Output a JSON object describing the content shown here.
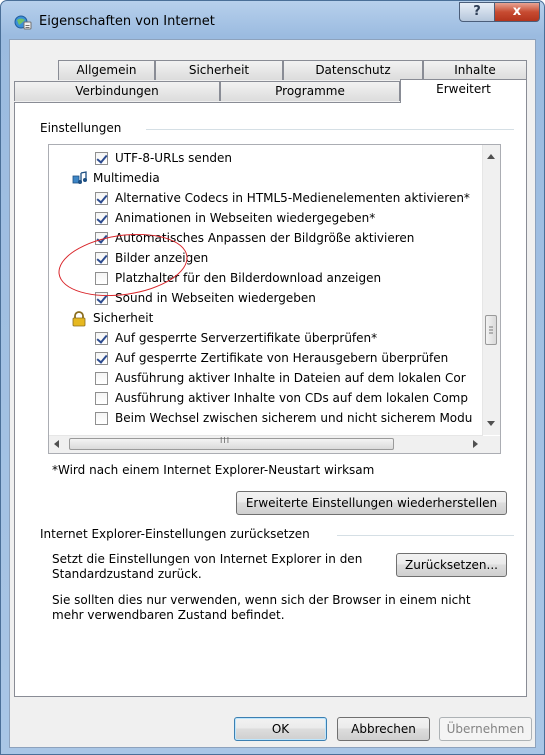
{
  "window": {
    "title": "Eigenschaften von Internet",
    "help_label": "?",
    "close_label": "x"
  },
  "tabs_row1": [
    {
      "label": "Allgemein"
    },
    {
      "label": "Sicherheit"
    },
    {
      "label": "Datenschutz"
    },
    {
      "label": "Inhalte"
    }
  ],
  "tabs_row2": [
    {
      "label": "Verbindungen"
    },
    {
      "label": "Programme"
    },
    {
      "label": "Erweitert",
      "selected": true
    }
  ],
  "settings": {
    "group_label": "Einstellungen",
    "items": [
      {
        "type": "checkbox",
        "label": "UTF-8-URLs senden",
        "checked": true
      },
      {
        "type": "category",
        "label": "Multimedia",
        "icon": "multimedia-icon"
      },
      {
        "type": "checkbox",
        "label": "Alternative Codecs in HTML5-Medienelementen aktivieren*",
        "checked": true
      },
      {
        "type": "checkbox",
        "label": "Animationen in Webseiten wiedergegeben*",
        "checked": true
      },
      {
        "type": "checkbox",
        "label": "Automatisches Anpassen der Bildgröße aktivieren",
        "checked": true
      },
      {
        "type": "checkbox",
        "label": "Bilder anzeigen",
        "checked": true
      },
      {
        "type": "checkbox",
        "label": "Platzhalter für den Bilderdownload anzeigen",
        "checked": false
      },
      {
        "type": "checkbox",
        "label": "Sound in Webseiten wiedergeben",
        "checked": true
      },
      {
        "type": "category",
        "label": "Sicherheit",
        "icon": "lock-icon"
      },
      {
        "type": "checkbox",
        "label": "Auf gesperrte Serverzertifikate überprüfen*",
        "checked": true
      },
      {
        "type": "checkbox",
        "label": "Auf gesperrte Zertifikate von Herausgebern überprüfen",
        "checked": true
      },
      {
        "type": "checkbox",
        "label": "Ausführung aktiver Inhalte in Dateien auf dem lokalen Cor",
        "checked": false
      },
      {
        "type": "checkbox",
        "label": "Ausführung aktiver Inhalte von CDs auf dem lokalen Comp",
        "checked": false
      },
      {
        "type": "checkbox",
        "label": "Beim Wechsel zwischen sicherem und nicht sicherem Modu",
        "checked": false
      }
    ],
    "hscroll_grip": "III",
    "restart_note": "*Wird nach einem Internet Explorer-Neustart wirksam",
    "restore_button": "Erweiterte Einstellungen wiederherstellen"
  },
  "reset": {
    "group_label": "Internet Explorer-Einstellungen zurücksetzen",
    "description_line1": "Setzt die Einstellungen von Internet Explorer in den",
    "description_line2": "Standardzustand zurück.",
    "button_label": "Zurücksetzen...",
    "warning_line1": "Sie sollten dies nur verwenden, wenn sich der Browser in einem nicht",
    "warning_line2": "mehr verwendbaren Zustand befindet."
  },
  "footer": {
    "ok_label": "OK",
    "cancel_label": "Abbrechen",
    "apply_label": "Übernehmen"
  },
  "colors": {
    "annotation": "#d9252a",
    "check": "#2c4b8f"
  }
}
